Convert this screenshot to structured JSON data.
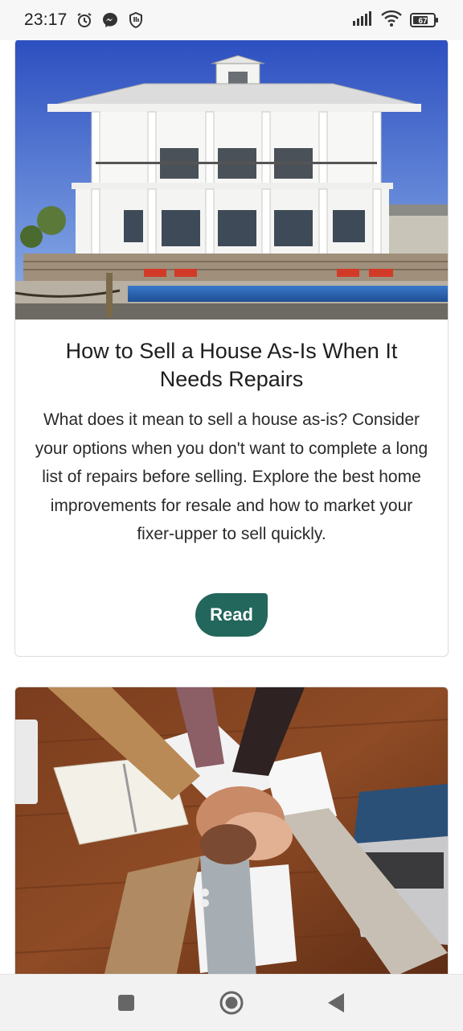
{
  "status_bar": {
    "time": "23:17",
    "left_icons": [
      "alarm-icon",
      "messenger-icon",
      "shield-hand-icon"
    ],
    "right_icons": [
      "signal-icon",
      "wifi-icon",
      "battery-icon"
    ],
    "battery_level": "67"
  },
  "articles": [
    {
      "image": "house-pool-photo",
      "title": "How to Sell a House As-Is When It Needs Repairs",
      "description": "What does it mean to sell a house as-is? Consider your options when you don't want to complete a long list of repairs before selling. Explore the best home improvements for resale and how to market your fixer-upper to sell quickly.",
      "button_label": "Read"
    },
    {
      "image": "team-hands-photo"
    }
  ],
  "colors": {
    "accent": "#22665c",
    "status_bar_bg": "#f7f7f7",
    "nav_bar_bg": "#f2f2f2"
  },
  "nav_bar": {
    "buttons": [
      "recents-square-icon",
      "home-circle-icon",
      "back-triangle-icon"
    ]
  }
}
